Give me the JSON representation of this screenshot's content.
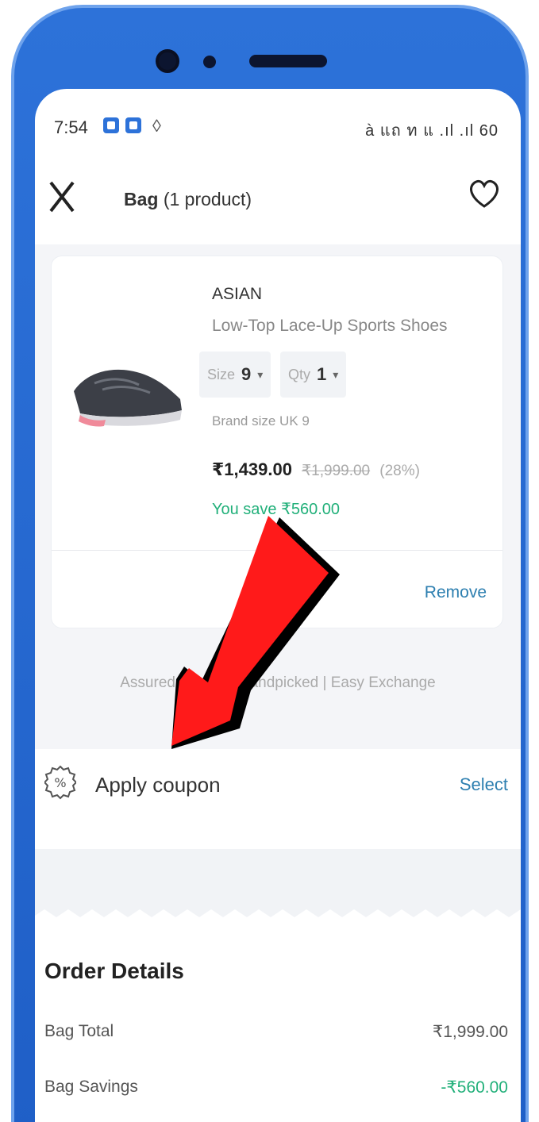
{
  "status_bar": {
    "time": "7:54",
    "right_icons": "à แถ ท แ .ıl .ıl 60"
  },
  "header": {
    "title_bold": "Bag",
    "title_count": "(1 product)"
  },
  "product": {
    "brand": "ASIAN",
    "name": "Low-Top Lace-Up Sports Shoes",
    "size_label": "Size",
    "size_value": "9",
    "qty_label": "Qty",
    "qty_value": "1",
    "brand_size": "Brand size UK 9",
    "price": "₹1,439.00",
    "mrp": "₹1,999.00",
    "discount": "(28%)",
    "savings": "You save ₹560.00",
    "remove_label": "Remove"
  },
  "assured_text": "Assured Quality | Handpicked | Easy Exchange",
  "coupon": {
    "label": "Apply coupon",
    "select_label": "Select"
  },
  "order_details": {
    "title": "Order Details",
    "rows": [
      {
        "label": "Bag Total",
        "amount": "₹1,999.00"
      },
      {
        "label": "Bag Savings",
        "amount": "-₹560.00"
      }
    ]
  },
  "colors": {
    "phone_frame": "#2d72d9",
    "link_blue": "#2d7fb0",
    "savings_green": "#22b07a",
    "arrow_red": "#ff1a1a"
  },
  "icons": [
    "close-icon",
    "heart-icon",
    "coupon-icon",
    "shoe-image",
    "red-arrow-annotation"
  ]
}
